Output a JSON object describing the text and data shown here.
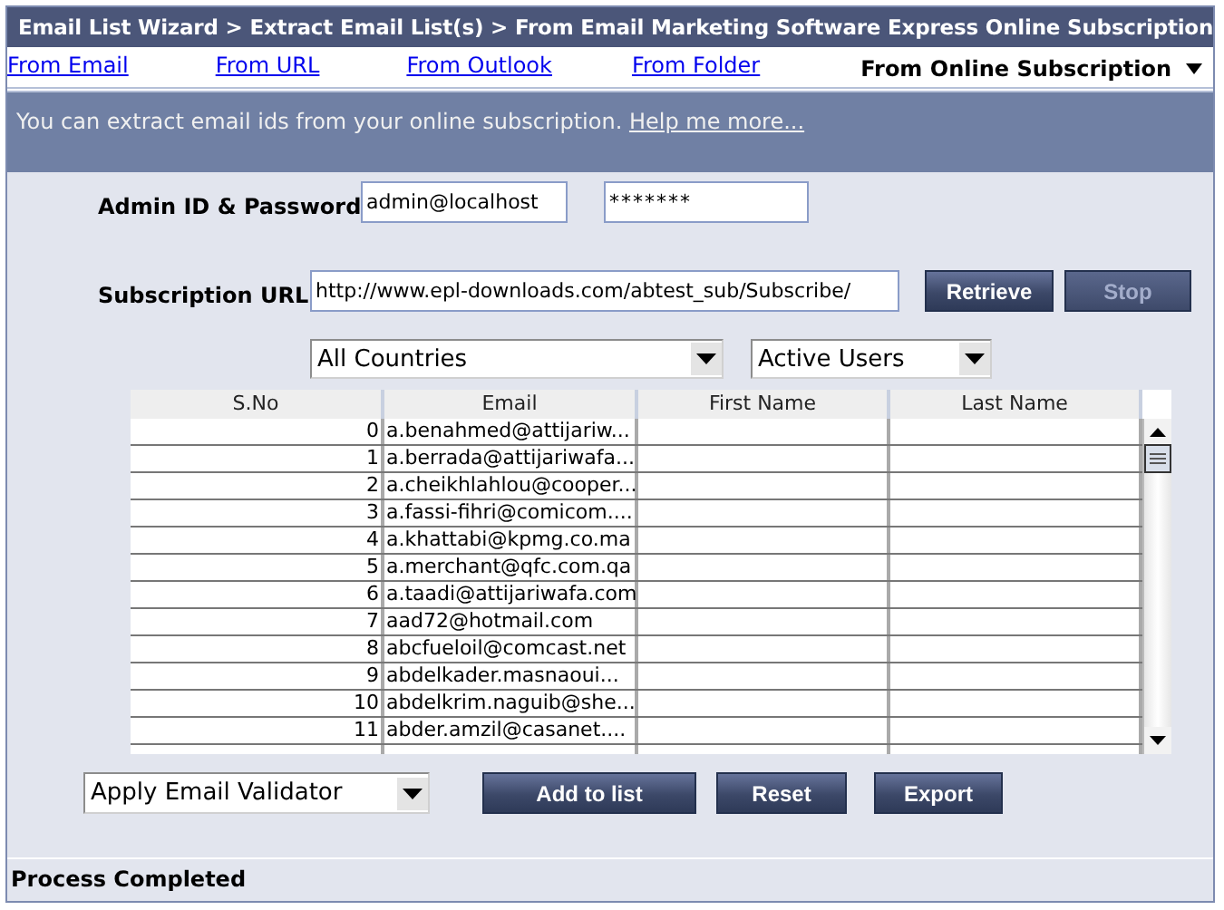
{
  "window": {
    "title": "Email List Wizard > Extract Email List(s) > From Email Marketing Software Express Online Subscription"
  },
  "tabs": [
    {
      "label": "From Email",
      "selected": false
    },
    {
      "label": "From URL",
      "selected": false
    },
    {
      "label": "From Outlook",
      "selected": false
    },
    {
      "label": "From Folder",
      "selected": false
    },
    {
      "label": "From Online Subscription",
      "selected": true
    }
  ],
  "info": {
    "text": "You can extract email ids from your online subscription.",
    "link": "Help me more..."
  },
  "credentials": {
    "label": "Admin ID & Password",
    "admin_id": "admin@localhost",
    "password": "*******"
  },
  "subscription": {
    "label": "Subscription URL",
    "url": "http://www.epl-downloads.com/abtest_sub/Subscribe/",
    "buttons": [
      {
        "label": "Retrieve",
        "disabled": false
      },
      {
        "label": "Stop",
        "disabled": true
      }
    ]
  },
  "filters": [
    {
      "value": "All Countries"
    },
    {
      "value": "Active Users"
    }
  ],
  "table": {
    "columns": [
      "S.No",
      "Email",
      "First Name",
      "Last Name"
    ],
    "rows": [
      {
        "s_no": "0",
        "email": "a.benahmed@attijariw..."
      },
      {
        "s_no": "1",
        "email": "a.berrada@attijariwafa..."
      },
      {
        "s_no": "2",
        "email": "a.cheikhlahlou@cooper..."
      },
      {
        "s_no": "3",
        "email": "a.fassi-fihri@comicom...."
      },
      {
        "s_no": "4",
        "email": "a.khattabi@kpmg.co.ma"
      },
      {
        "s_no": "5",
        "email": "a.merchant@qfc.com.qa"
      },
      {
        "s_no": "6",
        "email": "a.taadi@attijariwafa.com"
      },
      {
        "s_no": "7",
        "email": "aad72@hotmail.com"
      },
      {
        "s_no": "8",
        "email": "abcfueloil@comcast.net"
      },
      {
        "s_no": "9",
        "email": "abdelkader.masnaoui..."
      },
      {
        "s_no": "10",
        "email": "abdelkrim.naguib@she..."
      },
      {
        "s_no": "11",
        "email": "abder.amzil@casanet...."
      }
    ]
  },
  "actions": {
    "validator": "Apply Email Validator",
    "buttons": [
      {
        "label": "Add to list",
        "disabled": false
      },
      {
        "label": "Reset",
        "disabled": false
      },
      {
        "label": "Export",
        "disabled": false
      }
    ]
  },
  "status_bar": "Process Completed"
}
